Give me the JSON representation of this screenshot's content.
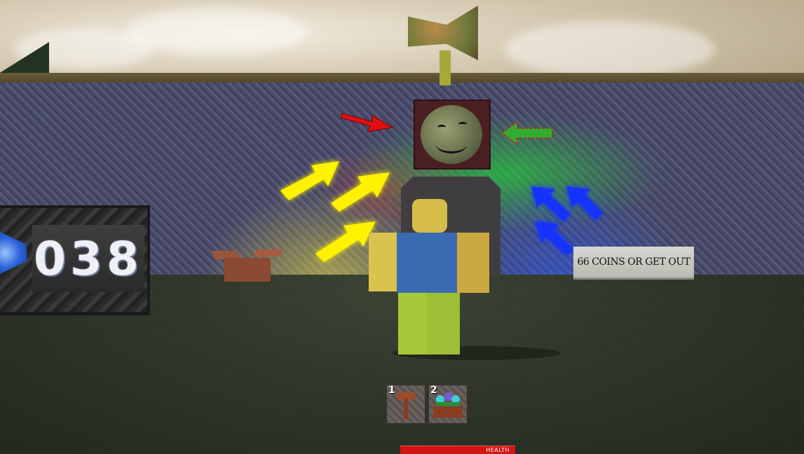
{
  "hud": {
    "coin_counter": "038",
    "hotbar": {
      "slots": [
        {
          "number": "1",
          "icon": "hammer-tool-icon"
        },
        {
          "number": "2",
          "icon": "flower-planter-icon"
        }
      ]
    },
    "health": {
      "label": "HEALTH",
      "fraction": 1.0,
      "color": "#d41414"
    }
  },
  "world": {
    "sign_text": "66 COINS OR GET OUT",
    "arrow_colors": {
      "yellow": "#fff200",
      "blue": "#1830ff",
      "red": "#e01010",
      "green": "#2fae2f"
    }
  }
}
